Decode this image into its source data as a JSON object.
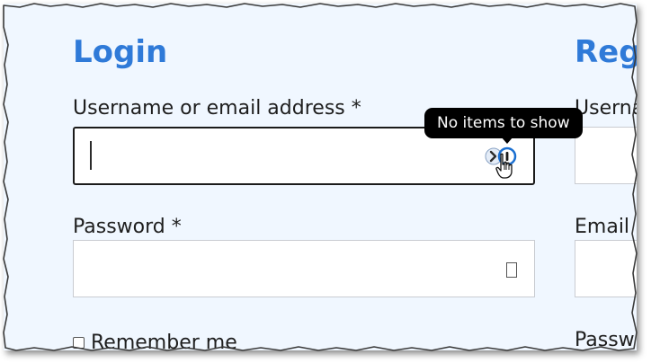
{
  "login": {
    "heading": "Login",
    "username_label": "Username or email address *",
    "username_value": "",
    "password_label": "Password *",
    "password_value": "",
    "remember_label": "Remember me"
  },
  "register": {
    "heading": "Regi",
    "username_label": "Userna",
    "email_label": "Email",
    "password_label": "Passw"
  },
  "tooltip": {
    "text": "No items to show"
  },
  "icons": {
    "password_manager": "password-manager-icon",
    "password_field_glyph": "password-key-icon",
    "cursor": "hand-pointer-cursor-icon"
  },
  "colors": {
    "heading": "#2f7ad8",
    "page_background": "#f0f7ff",
    "tooltip_background": "#000000",
    "focused_border": "#1b1b1b"
  }
}
